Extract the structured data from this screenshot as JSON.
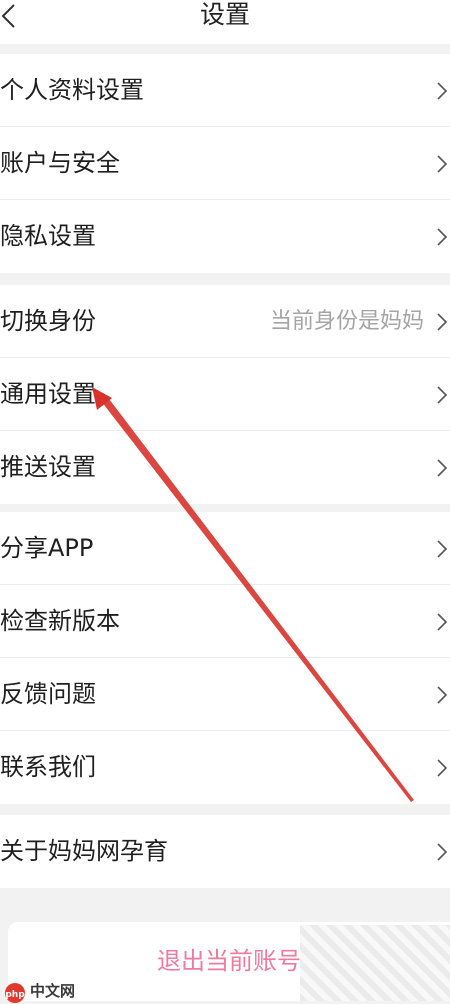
{
  "header": {
    "title": "设置",
    "back_icon": "chevron-left-icon"
  },
  "groups": [
    {
      "items": [
        {
          "label": "个人资料设置"
        },
        {
          "label": "账户与安全"
        },
        {
          "label": "隐私设置"
        }
      ]
    },
    {
      "items": [
        {
          "label": "切换身份",
          "value": "当前身份是妈妈"
        },
        {
          "label": "通用设置"
        },
        {
          "label": "推送设置"
        }
      ]
    },
    {
      "items": [
        {
          "label": "分享APP"
        },
        {
          "label": "检查新版本"
        },
        {
          "label": "反馈问题"
        },
        {
          "label": "联系我们"
        }
      ]
    },
    {
      "items": [
        {
          "label": "关于妈妈网孕育"
        }
      ]
    }
  ],
  "logout_label": "退出当前账号",
  "watermark": {
    "text": "中文网",
    "logo": "php"
  },
  "colors": {
    "accent": "#f07a9f",
    "annotation_arrow": "#d8322c",
    "background": "#f2f2f2"
  }
}
